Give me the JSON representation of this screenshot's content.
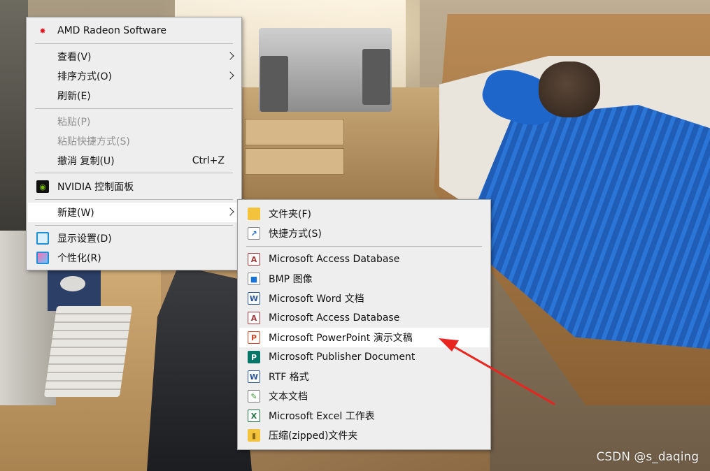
{
  "context_menu": {
    "items": [
      {
        "label": "AMD Radeon Software",
        "icon": "amd-radeon-icon"
      },
      {
        "label": "查看(V)",
        "submenu": true
      },
      {
        "label": "排序方式(O)",
        "submenu": true
      },
      {
        "label": "刷新(E)"
      },
      {
        "label": "粘贴(P)",
        "disabled": true
      },
      {
        "label": "粘贴快捷方式(S)",
        "disabled": true
      },
      {
        "label": "撤消 复制(U)",
        "shortcut": "Ctrl+Z"
      },
      {
        "label": "NVIDIA 控制面板",
        "icon": "nvidia-icon"
      },
      {
        "label": "新建(W)",
        "submenu": true,
        "highlighted": true
      },
      {
        "label": "显示设置(D)",
        "icon": "display-settings-icon"
      },
      {
        "label": "个性化(R)",
        "icon": "personalize-icon"
      }
    ]
  },
  "new_submenu": {
    "items": [
      {
        "label": "文件夹(F)",
        "icon": "folder-icon"
      },
      {
        "label": "快捷方式(S)",
        "icon": "shortcut-icon"
      },
      {
        "label": "Microsoft Access Database",
        "icon": "access-icon"
      },
      {
        "label": "BMP 图像",
        "icon": "bmp-image-icon"
      },
      {
        "label": "Microsoft Word 文档",
        "icon": "word-icon"
      },
      {
        "label": "Microsoft Access Database",
        "icon": "access-icon"
      },
      {
        "label": "Microsoft PowerPoint 演示文稿",
        "icon": "powerpoint-icon",
        "highlighted": true
      },
      {
        "label": "Microsoft Publisher Document",
        "icon": "publisher-icon"
      },
      {
        "label": "RTF 格式",
        "icon": "rtf-icon"
      },
      {
        "label": "文本文档",
        "icon": "text-document-icon"
      },
      {
        "label": "Microsoft Excel 工作表",
        "icon": "excel-icon"
      },
      {
        "label": "压缩(zipped)文件夹",
        "icon": "zip-folder-icon"
      }
    ]
  },
  "watermark": "CSDN @s_daqing",
  "colors": {
    "menu_background": "#eeeeee",
    "highlight": "#ffffff",
    "annotation_arrow": "#e8251f"
  }
}
